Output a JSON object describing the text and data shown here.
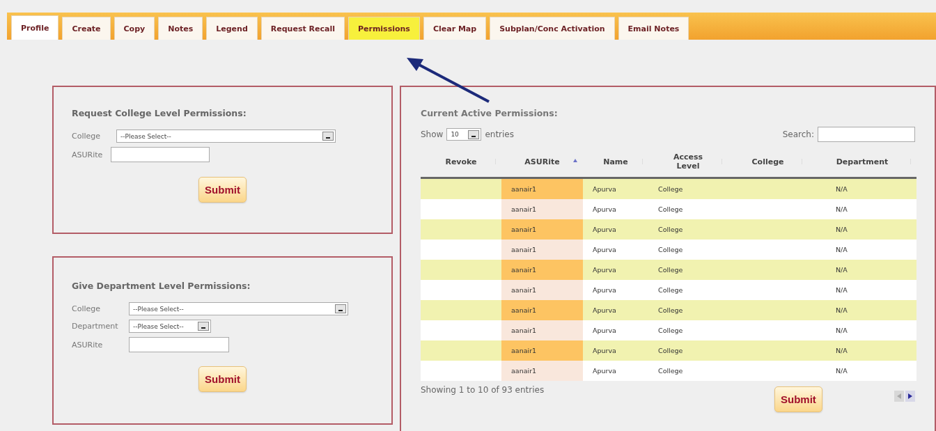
{
  "tabs": [
    {
      "label": "Profile",
      "selected": true,
      "highlighted": false
    },
    {
      "label": "Create",
      "selected": false,
      "highlighted": false
    },
    {
      "label": "Copy",
      "selected": false,
      "highlighted": false
    },
    {
      "label": "Notes",
      "selected": false,
      "highlighted": false
    },
    {
      "label": "Legend",
      "selected": false,
      "highlighted": false
    },
    {
      "label": "Request Recall",
      "selected": false,
      "highlighted": false
    },
    {
      "label": "Permissions",
      "selected": false,
      "highlighted": true
    },
    {
      "label": "Clear Map",
      "selected": false,
      "highlighted": false
    },
    {
      "label": "Subplan/Conc Activation",
      "selected": false,
      "highlighted": false
    },
    {
      "label": "Email Notes",
      "selected": false,
      "highlighted": false
    }
  ],
  "college_request": {
    "title": "Request College Level Permissions:",
    "fields": [
      {
        "kind": "select",
        "label": "College",
        "value": "--Please Select--"
      },
      {
        "kind": "text",
        "label": "ASURite"
      }
    ],
    "submit": "Submit"
  },
  "department_grant": {
    "title": "Give Department Level Permissions:",
    "fields": [
      {
        "kind": "select",
        "label": "College",
        "value": "--Please Select--"
      },
      {
        "kind": "select",
        "label": "Department",
        "value": "--Please Select--"
      },
      {
        "kind": "text",
        "label": "ASURite"
      }
    ],
    "submit": "Submit"
  },
  "active_permissions": {
    "title": "Current Active Permissions:",
    "show_label": "Show",
    "page_size": "10",
    "entries_label": "entries",
    "search_label": "Search:",
    "columns": [
      {
        "label": "Revoke",
        "sorted": false
      },
      {
        "label": "ASURite",
        "sorted": true
      },
      {
        "label": "Name",
        "sorted": false
      },
      {
        "label": "Access Level",
        "sorted": false
      },
      {
        "label": "College",
        "sorted": false
      },
      {
        "label": "Department",
        "sorted": false
      }
    ],
    "rows": [
      {
        "asurite": "aanair1",
        "name": "Apurva",
        "access_level": "College",
        "department": "N/A"
      },
      {
        "asurite": "aanair1",
        "name": "Apurva",
        "access_level": "College",
        "department": "N/A"
      },
      {
        "asurite": "aanair1",
        "name": "Apurva",
        "access_level": "College",
        "department": "N/A"
      },
      {
        "asurite": "aanair1",
        "name": "Apurva",
        "access_level": "College",
        "department": "N/A"
      },
      {
        "asurite": "aanair1",
        "name": "Apurva",
        "access_level": "College",
        "department": "N/A"
      },
      {
        "asurite": "aanair1",
        "name": "Apurva",
        "access_level": "College",
        "department": "N/A"
      },
      {
        "asurite": "aanair1",
        "name": "Apurva",
        "access_level": "College",
        "department": "N/A"
      },
      {
        "asurite": "aanair1",
        "name": "Apurva",
        "access_level": "College",
        "department": "N/A"
      },
      {
        "asurite": "aanair1",
        "name": "Apurva",
        "access_level": "College",
        "department": "N/A"
      },
      {
        "asurite": "aanair1",
        "name": "Apurva",
        "access_level": "College",
        "department": "N/A"
      }
    ],
    "info": "Showing 1 to 10 of 93 entries",
    "submit": "Submit"
  }
}
